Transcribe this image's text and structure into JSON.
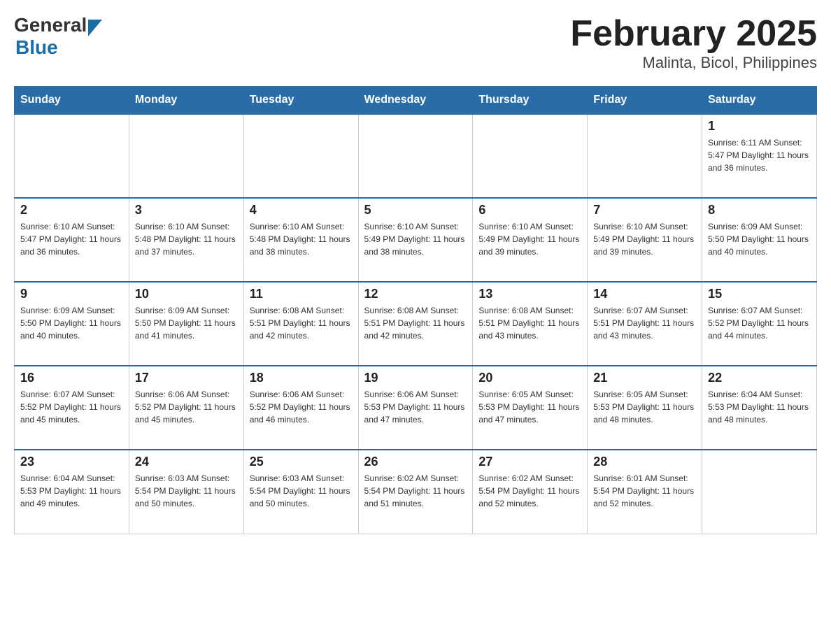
{
  "header": {
    "logo": {
      "general": "General",
      "blue": "Blue"
    },
    "title": "February 2025",
    "subtitle": "Malinta, Bicol, Philippines"
  },
  "weekdays": [
    "Sunday",
    "Monday",
    "Tuesday",
    "Wednesday",
    "Thursday",
    "Friday",
    "Saturday"
  ],
  "weeks": [
    [
      {
        "day": "",
        "info": ""
      },
      {
        "day": "",
        "info": ""
      },
      {
        "day": "",
        "info": ""
      },
      {
        "day": "",
        "info": ""
      },
      {
        "day": "",
        "info": ""
      },
      {
        "day": "",
        "info": ""
      },
      {
        "day": "1",
        "info": "Sunrise: 6:11 AM\nSunset: 5:47 PM\nDaylight: 11 hours\nand 36 minutes."
      }
    ],
    [
      {
        "day": "2",
        "info": "Sunrise: 6:10 AM\nSunset: 5:47 PM\nDaylight: 11 hours\nand 36 minutes."
      },
      {
        "day": "3",
        "info": "Sunrise: 6:10 AM\nSunset: 5:48 PM\nDaylight: 11 hours\nand 37 minutes."
      },
      {
        "day": "4",
        "info": "Sunrise: 6:10 AM\nSunset: 5:48 PM\nDaylight: 11 hours\nand 38 minutes."
      },
      {
        "day": "5",
        "info": "Sunrise: 6:10 AM\nSunset: 5:49 PM\nDaylight: 11 hours\nand 38 minutes."
      },
      {
        "day": "6",
        "info": "Sunrise: 6:10 AM\nSunset: 5:49 PM\nDaylight: 11 hours\nand 39 minutes."
      },
      {
        "day": "7",
        "info": "Sunrise: 6:10 AM\nSunset: 5:49 PM\nDaylight: 11 hours\nand 39 minutes."
      },
      {
        "day": "8",
        "info": "Sunrise: 6:09 AM\nSunset: 5:50 PM\nDaylight: 11 hours\nand 40 minutes."
      }
    ],
    [
      {
        "day": "9",
        "info": "Sunrise: 6:09 AM\nSunset: 5:50 PM\nDaylight: 11 hours\nand 40 minutes."
      },
      {
        "day": "10",
        "info": "Sunrise: 6:09 AM\nSunset: 5:50 PM\nDaylight: 11 hours\nand 41 minutes."
      },
      {
        "day": "11",
        "info": "Sunrise: 6:08 AM\nSunset: 5:51 PM\nDaylight: 11 hours\nand 42 minutes."
      },
      {
        "day": "12",
        "info": "Sunrise: 6:08 AM\nSunset: 5:51 PM\nDaylight: 11 hours\nand 42 minutes."
      },
      {
        "day": "13",
        "info": "Sunrise: 6:08 AM\nSunset: 5:51 PM\nDaylight: 11 hours\nand 43 minutes."
      },
      {
        "day": "14",
        "info": "Sunrise: 6:07 AM\nSunset: 5:51 PM\nDaylight: 11 hours\nand 43 minutes."
      },
      {
        "day": "15",
        "info": "Sunrise: 6:07 AM\nSunset: 5:52 PM\nDaylight: 11 hours\nand 44 minutes."
      }
    ],
    [
      {
        "day": "16",
        "info": "Sunrise: 6:07 AM\nSunset: 5:52 PM\nDaylight: 11 hours\nand 45 minutes."
      },
      {
        "day": "17",
        "info": "Sunrise: 6:06 AM\nSunset: 5:52 PM\nDaylight: 11 hours\nand 45 minutes."
      },
      {
        "day": "18",
        "info": "Sunrise: 6:06 AM\nSunset: 5:52 PM\nDaylight: 11 hours\nand 46 minutes."
      },
      {
        "day": "19",
        "info": "Sunrise: 6:06 AM\nSunset: 5:53 PM\nDaylight: 11 hours\nand 47 minutes."
      },
      {
        "day": "20",
        "info": "Sunrise: 6:05 AM\nSunset: 5:53 PM\nDaylight: 11 hours\nand 47 minutes."
      },
      {
        "day": "21",
        "info": "Sunrise: 6:05 AM\nSunset: 5:53 PM\nDaylight: 11 hours\nand 48 minutes."
      },
      {
        "day": "22",
        "info": "Sunrise: 6:04 AM\nSunset: 5:53 PM\nDaylight: 11 hours\nand 48 minutes."
      }
    ],
    [
      {
        "day": "23",
        "info": "Sunrise: 6:04 AM\nSunset: 5:53 PM\nDaylight: 11 hours\nand 49 minutes."
      },
      {
        "day": "24",
        "info": "Sunrise: 6:03 AM\nSunset: 5:54 PM\nDaylight: 11 hours\nand 50 minutes."
      },
      {
        "day": "25",
        "info": "Sunrise: 6:03 AM\nSunset: 5:54 PM\nDaylight: 11 hours\nand 50 minutes."
      },
      {
        "day": "26",
        "info": "Sunrise: 6:02 AM\nSunset: 5:54 PM\nDaylight: 11 hours\nand 51 minutes."
      },
      {
        "day": "27",
        "info": "Sunrise: 6:02 AM\nSunset: 5:54 PM\nDaylight: 11 hours\nand 52 minutes."
      },
      {
        "day": "28",
        "info": "Sunrise: 6:01 AM\nSunset: 5:54 PM\nDaylight: 11 hours\nand 52 minutes."
      },
      {
        "day": "",
        "info": ""
      }
    ]
  ]
}
